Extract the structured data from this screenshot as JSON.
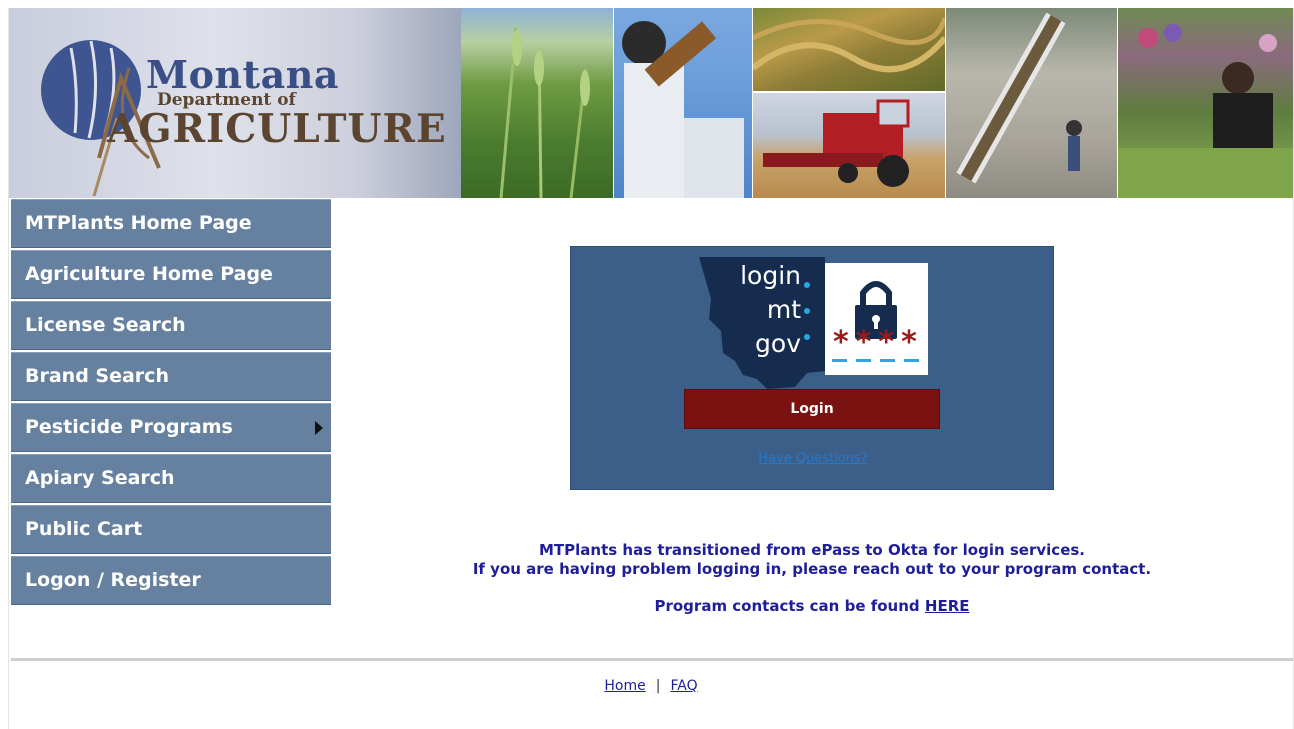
{
  "header": {
    "logo_line1": "Montana",
    "logo_line2": "Department of",
    "logo_line3": "AGRICULTURE"
  },
  "nav": {
    "items": [
      {
        "label": "MTPlants Home Page"
      },
      {
        "label": "Agriculture Home Page"
      },
      {
        "label": "License Search"
      },
      {
        "label": "Brand Search"
      },
      {
        "label": "Pesticide Programs"
      },
      {
        "label": "Apiary Search"
      },
      {
        "label": "Public Cart"
      },
      {
        "label": "Logon / Register"
      }
    ]
  },
  "login": {
    "logo_login": "login",
    "logo_mt": "mt",
    "logo_gov": "gov",
    "logo_stars": "****",
    "button_label": "Login",
    "questions_link": "Have Questions?"
  },
  "message": {
    "line1": "MTPlants has transitioned from ePass to Okta for login services.",
    "line2": "If you are having problem logging in, please reach out to your program contact.",
    "line3_prefix": "Program contacts can be found",
    "line3_link": "HERE"
  },
  "footer": {
    "home": "Home",
    "separator": "|",
    "faq": "FAQ"
  },
  "colors": {
    "nav_bg": "#66819f",
    "login_panel": "#3c5f8a",
    "login_button": "#7a1212",
    "message_text": "#1e1e9a"
  }
}
